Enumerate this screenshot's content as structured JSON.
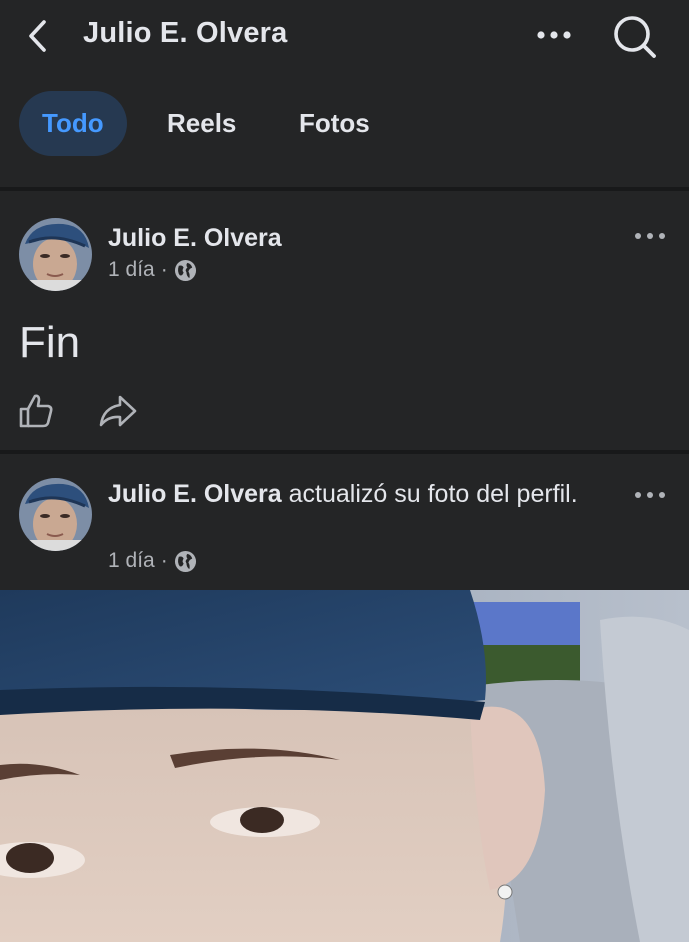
{
  "header": {
    "title": "Julio E. Olvera",
    "back_icon": "chevron-left-icon",
    "more_icon": "more-horizontal-icon",
    "search_icon": "search-icon"
  },
  "tabs": [
    {
      "label": "Todo",
      "active": true
    },
    {
      "label": "Reels",
      "active": false
    },
    {
      "label": "Fotos",
      "active": false
    }
  ],
  "posts": [
    {
      "author": "Julio E. Olvera",
      "action": "",
      "time": "1 día",
      "separator": "·",
      "privacy_icon": "globe-icon",
      "text": "Fin"
    },
    {
      "author": "Julio E. Olvera",
      "action": " actualizó su foto del perfil.",
      "time": "1 día",
      "separator": "·",
      "privacy_icon": "globe-icon"
    }
  ],
  "colors": {
    "background": "#242526",
    "separator": "#18191a",
    "text_primary": "#e4e6eb",
    "text_secondary": "#b0b3b8",
    "accent": "#4599ff",
    "active_tab_bg": "#263951"
  }
}
